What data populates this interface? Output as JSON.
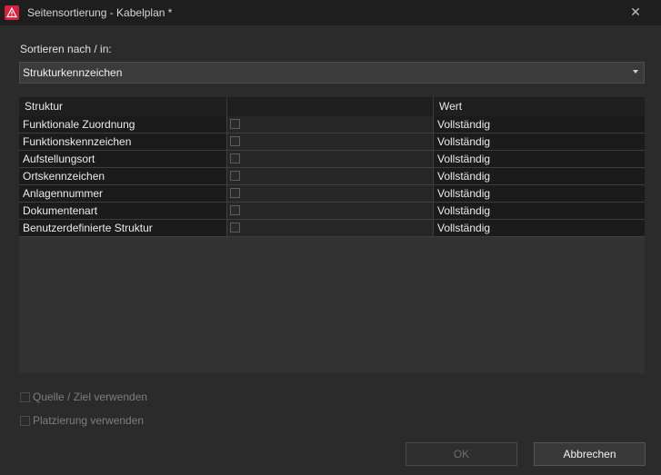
{
  "window": {
    "title": "Seitensortierung - Kabelplan *",
    "close_glyph": "✕"
  },
  "sort": {
    "label": "Sortieren nach / in:",
    "selected": "Strukturkennzeichen"
  },
  "table": {
    "headers": [
      "Struktur",
      "",
      "Wert"
    ],
    "rows": [
      {
        "struktur": "Funktionale Zuordnung",
        "checked": false,
        "wert": "Vollständig"
      },
      {
        "struktur": "Funktionskennzeichen",
        "checked": false,
        "wert": "Vollständig"
      },
      {
        "struktur": "Aufstellungsort",
        "checked": false,
        "wert": "Vollständig"
      },
      {
        "struktur": "Ortskennzeichen",
        "checked": false,
        "wert": "Vollständig"
      },
      {
        "struktur": "Anlagennummer",
        "checked": false,
        "wert": "Vollständig"
      },
      {
        "struktur": "Dokumentenart",
        "checked": false,
        "wert": "Vollständig"
      },
      {
        "struktur": "Benutzerdefinierte Struktur",
        "checked": false,
        "wert": "Vollständig"
      }
    ]
  },
  "options": {
    "source_target": {
      "label": "Quelle / Ziel verwenden",
      "checked": false,
      "enabled": false
    },
    "placement": {
      "label": "Platzierung verwenden",
      "checked": false,
      "enabled": false
    }
  },
  "buttons": {
    "ok": "OK",
    "cancel": "Abbrechen"
  },
  "colors": {
    "accent": "#d5223d",
    "background": "#2b2b2b",
    "titlebar": "#1e1e1e"
  }
}
